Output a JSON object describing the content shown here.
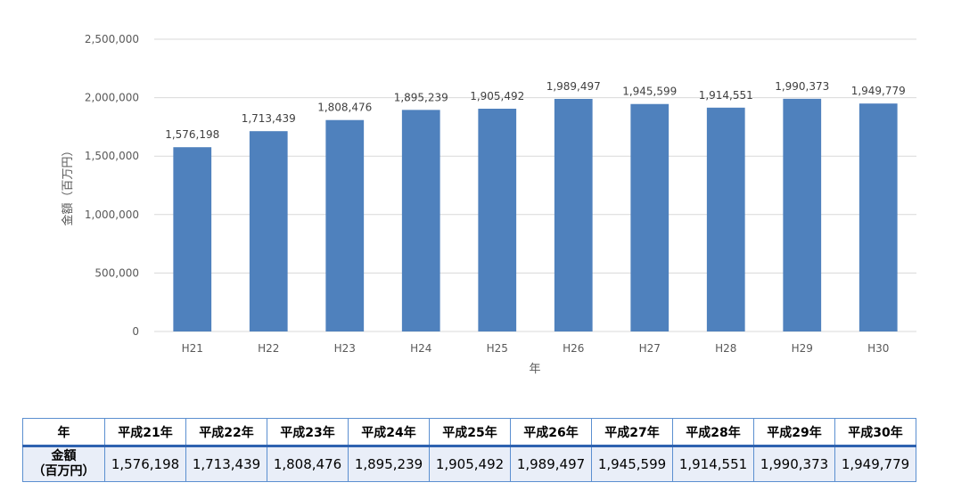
{
  "chart_data": {
    "type": "bar",
    "categories": [
      "H21",
      "H22",
      "H23",
      "H24",
      "H25",
      "H26",
      "H27",
      "H28",
      "H29",
      "H30"
    ],
    "values": [
      1576198,
      1713439,
      1808476,
      1895239,
      1905492,
      1989497,
      1945599,
      1914551,
      1990373,
      1949779
    ],
    "data_labels": [
      "1,576,198",
      "1,713,439",
      "1,808,476",
      "1,895,239",
      "1,905,492",
      "1,989,497",
      "1,945,599",
      "1,914,551",
      "1,990,373",
      "1,949,779"
    ],
    "xlabel": "年",
    "ylabel": "金額（百万円）",
    "ylim": [
      0,
      2500000
    ],
    "yticks": [
      0,
      500000,
      1000000,
      1500000,
      2000000,
      2500000
    ],
    "ytick_labels": [
      "0",
      "500,000",
      "1,000,000",
      "1,500,000",
      "2,000,000",
      "2,500,000"
    ],
    "grid": true,
    "bar_color": "#4f81bd"
  },
  "table": {
    "header_label": "年",
    "columns": [
      "平成21年",
      "平成22年",
      "平成23年",
      "平成24年",
      "平成25年",
      "平成26年",
      "平成27年",
      "平成28年",
      "平成29年",
      "平成30年"
    ],
    "row_label_line1": "金額",
    "row_label_line2": "（百万円）",
    "values": [
      "1,576,198",
      "1,713,439",
      "1,808,476",
      "1,895,239",
      "1,905,492",
      "1,989,497",
      "1,945,599",
      "1,914,551",
      "1,990,373",
      "1,949,779"
    ]
  }
}
